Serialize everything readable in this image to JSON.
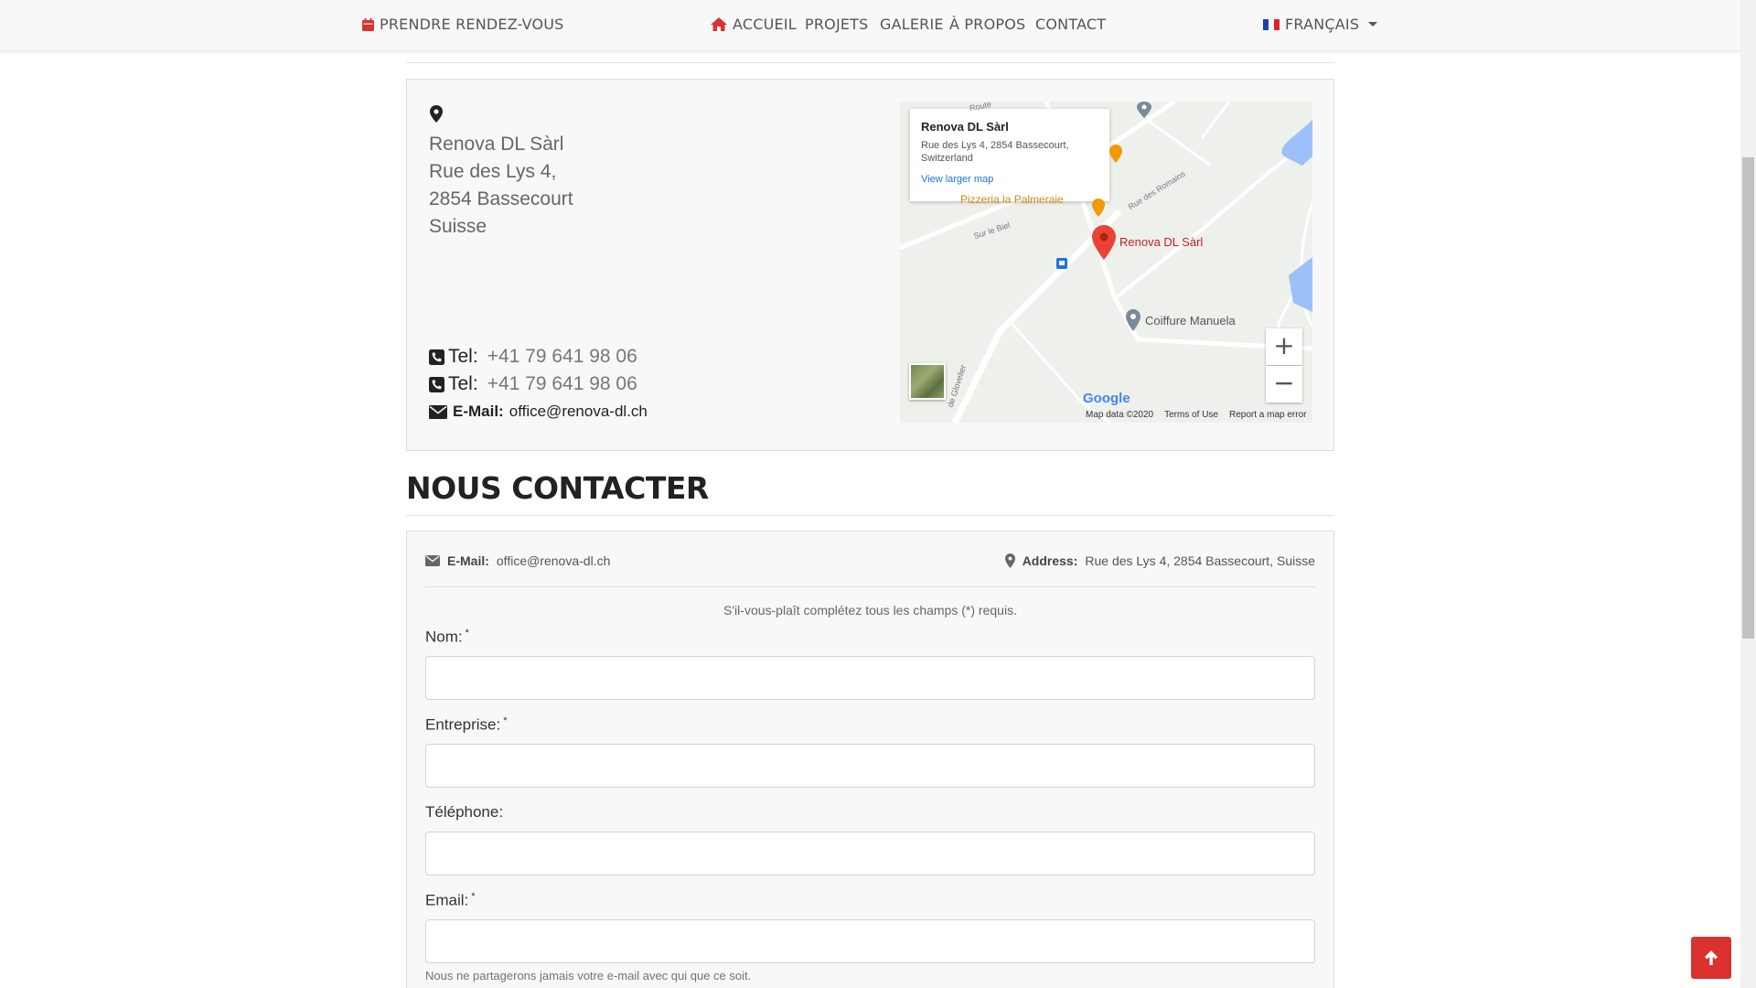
{
  "nav": {
    "appointment": "PRENDRE RENDEZ-VOUS",
    "home": "ACCUEIL",
    "projects": "PROJETS",
    "gallery": "GALERIE",
    "about": "À PROPOS",
    "contact": "CONTACT",
    "language": "FRANÇAIS"
  },
  "info": {
    "address_lines": [
      "Renova DL Sàrl",
      "Rue des Lys 4,",
      "2854 Bassecourt",
      "Suisse"
    ],
    "tel_label": "Tel:",
    "phones": [
      "+41 79 641 98 06",
      "+41 79 641 98 06"
    ],
    "email_label": "E-Mail:",
    "email": "office@renova-dl.ch"
  },
  "map": {
    "popup_title": "Renova DL Sàrl",
    "popup_address": "Rue des Lys 4, 2854 Bassecourt, Switzerland",
    "popup_link": "View larger map",
    "marker_label": "Renova DL Sàrl",
    "poi_coiffure": "Coiffure Manuela",
    "poi_pizzeria": "Pizzeria la Palmeraie",
    "street_romains": "Rue des Romains",
    "street_biel": "Sur le Biel",
    "street_route": "Route",
    "street_glovelier": "de Glovelier",
    "zoom_in": "+",
    "zoom_out": "−",
    "logo": "Google",
    "footer": [
      "Map data ©2020",
      "Terms of Use",
      "Report a map error"
    ]
  },
  "contact_section": {
    "title": "NOUS CONTACTER",
    "email_label": "E-Mail:",
    "email": "office@renova-dl.ch",
    "address_label": "Address:",
    "address": "Rue des Lys 4, 2854 Bassecourt, Suisse",
    "required_note": "S'il-vous-plaît complétez tous les champs (*) requis.",
    "fields": {
      "name": "Nom:",
      "company": "Entreprise:",
      "phone": "Téléphone:",
      "email": "Email:"
    },
    "required_mark": "*",
    "email_help": "Nous ne partagerons jamais votre e-mail avec qui que ce soit."
  },
  "colors": {
    "accent": "#d9322f",
    "nav_text": "#555555",
    "map_link": "#1a73e8"
  }
}
